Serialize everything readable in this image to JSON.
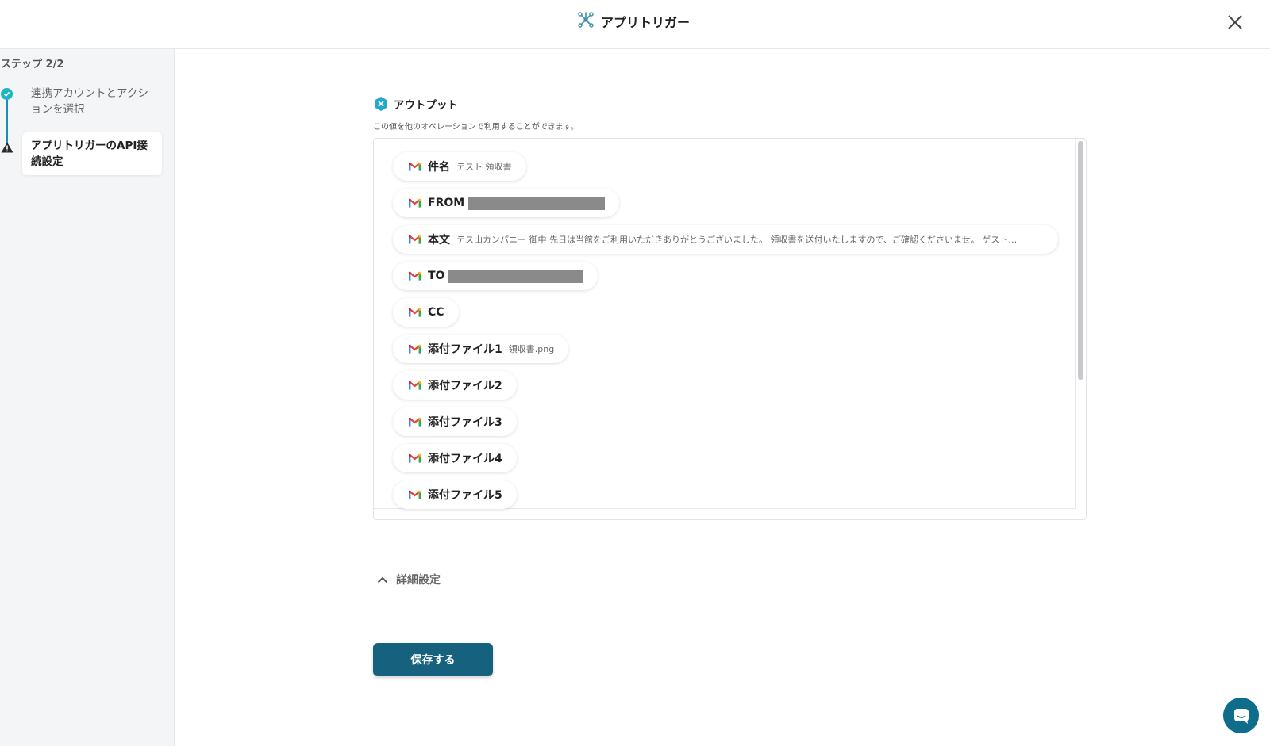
{
  "header": {
    "title": "アプリトリガー",
    "icon": "app-trigger-network-icon"
  },
  "sidebar": {
    "step_count": "ステップ 2/2",
    "steps": [
      {
        "label": "連携アカウントとアクションを選択",
        "status": "complete"
      },
      {
        "label": "アプリトリガーのAPI接続設定",
        "status": "warning",
        "active": true
      }
    ]
  },
  "output": {
    "title": "アウトプット",
    "description": "この値を他のオペレーションで利用することができます。",
    "items": [
      {
        "label": "件名",
        "value": "テスト 領収書"
      },
      {
        "label": "FROM",
        "value": "",
        "redacted": true
      },
      {
        "label": "本文",
        "value": "テス山カンパニー 御中 先日は当館をご利用いただきありがとうございました。 領収書を送付いたしますので、ご確認くださいませ。 ゲスト…"
      },
      {
        "label": "TO",
        "value": "",
        "redacted": true
      },
      {
        "label": "CC",
        "value": ""
      },
      {
        "label": "添付ファイル1",
        "value": "領収書.png"
      },
      {
        "label": "添付ファイル2",
        "value": ""
      },
      {
        "label": "添付ファイル3",
        "value": ""
      },
      {
        "label": "添付ファイル4",
        "value": ""
      },
      {
        "label": "添付ファイル5",
        "value": ""
      }
    ]
  },
  "advanced": {
    "label": "詳細設定"
  },
  "actions": {
    "save_label": "保存する"
  },
  "colors": {
    "accent": "#16627e",
    "step_complete": "#1cb4c9",
    "gmail_red": "#ea4335"
  }
}
